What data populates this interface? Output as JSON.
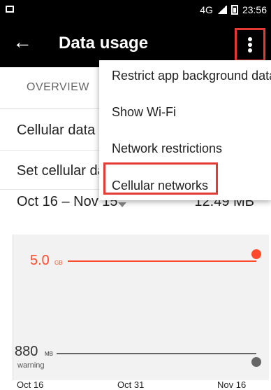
{
  "status_bar": {
    "network": "4G",
    "signal_label": "4G",
    "time": "23:56"
  },
  "appbar": {
    "back_icon": "arrow-left-icon",
    "title": "Data usage",
    "overflow_icon": "more-vert-icon"
  },
  "tabs": {
    "overview": "OVERVIEW"
  },
  "rows": {
    "cellular_data": "Cellular data",
    "set_cellular_data": "Set cellular data"
  },
  "date_row": {
    "range": "Oct 16 – Nov 15",
    "amount": "12.49 MB"
  },
  "chart_data": {
    "type": "line",
    "x": [
      "Oct 16",
      "Oct 31",
      "Nov 16"
    ],
    "series": [
      {
        "name": "",
        "values": [
          5.0,
          5.0,
          5.0
        ]
      },
      {
        "name": "",
        "values": [
          880,
          880,
          880
        ]
      }
    ],
    "annotations": [
      {
        "value": "5.0",
        "unit": "GB"
      },
      {
        "value": "880",
        "unit": "MB",
        "sublabel": "warning"
      }
    ],
    "colors": {
      "limit": "#ff4b2b",
      "warning": "#666666"
    }
  },
  "menu": {
    "items": [
      "Restrict app background data",
      "Show Wi-Fi",
      "Network restrictions",
      "Cellular networks"
    ]
  }
}
